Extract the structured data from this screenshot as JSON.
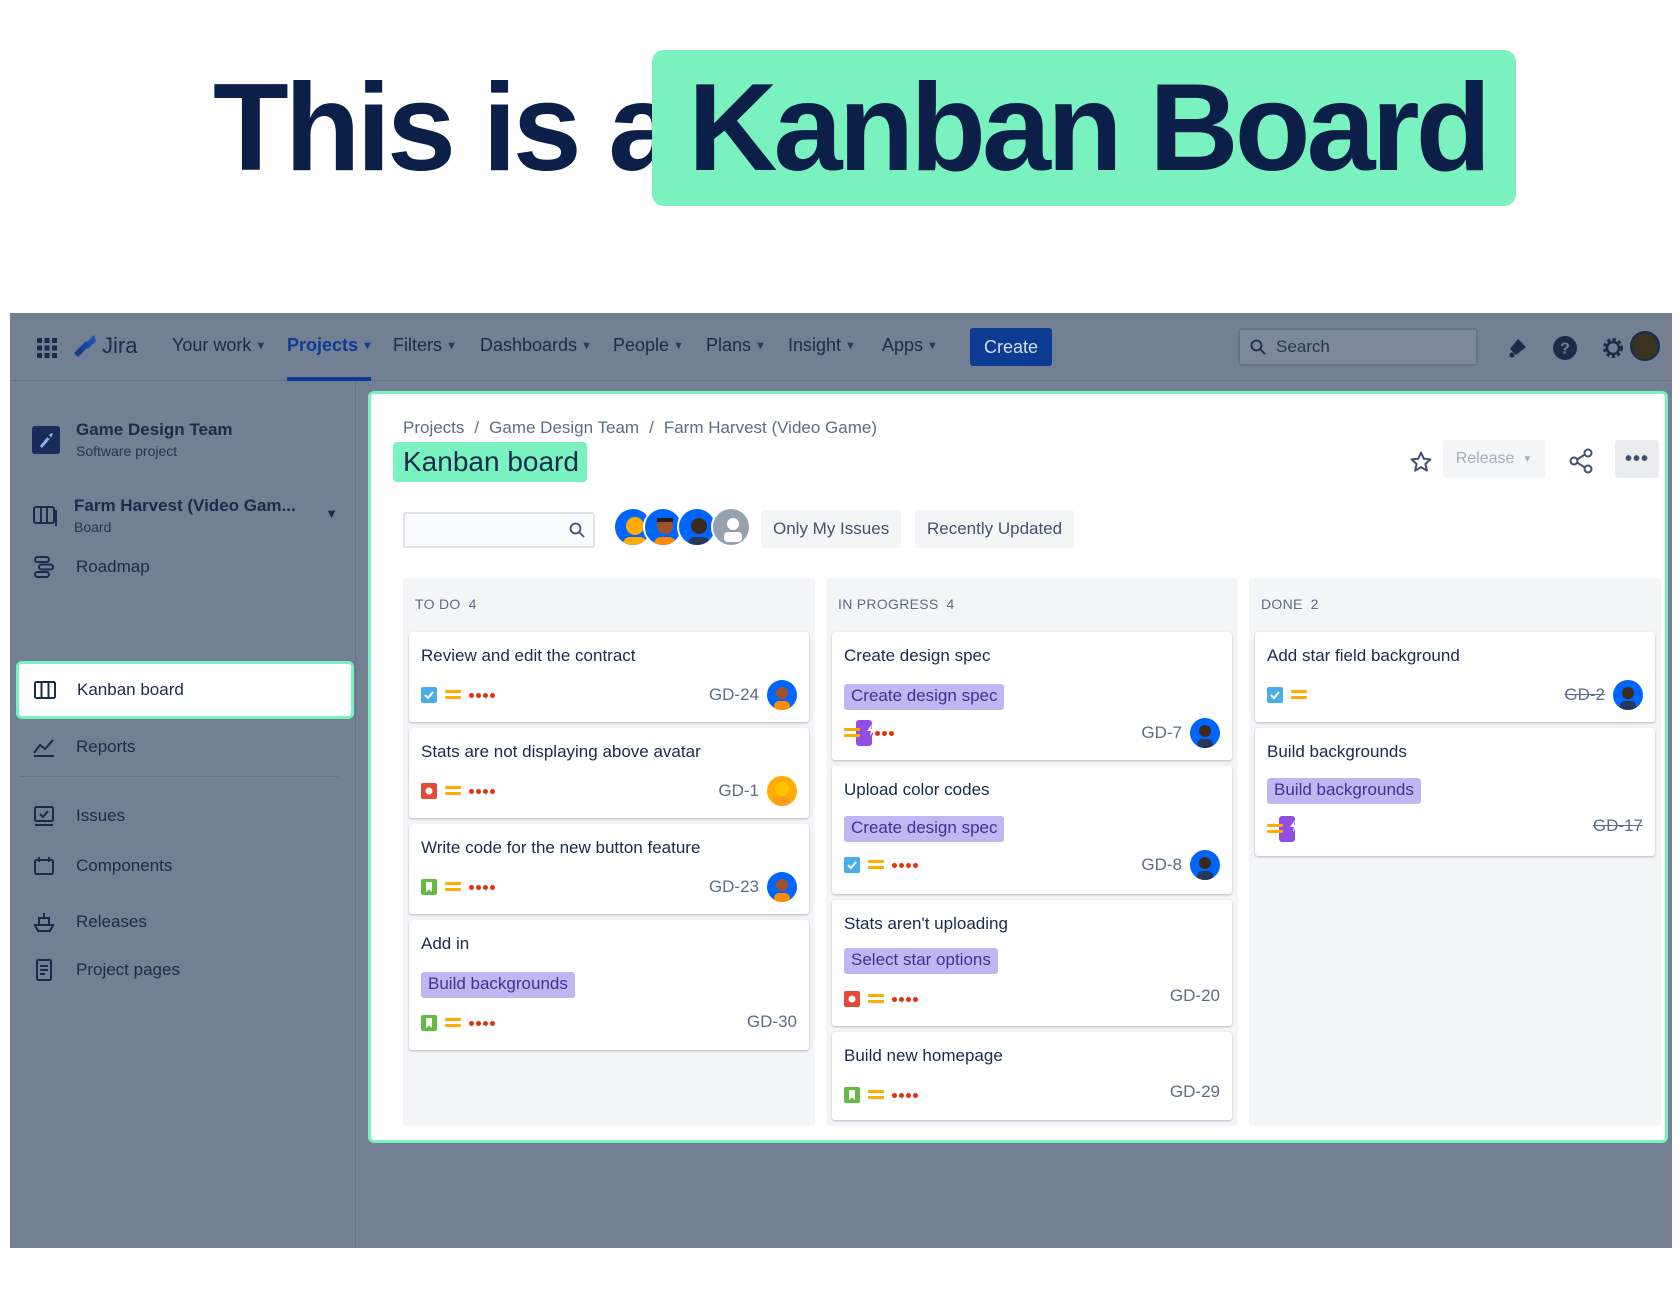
{
  "headline": {
    "plain": "This is a",
    "highlight": "Kanban Board"
  },
  "topnav": {
    "logo": "Jira",
    "items": [
      {
        "label": "Your work",
        "active": false
      },
      {
        "label": "Projects",
        "active": true
      },
      {
        "label": "Filters",
        "active": false
      },
      {
        "label": "Dashboards",
        "active": false
      },
      {
        "label": "People",
        "active": false
      },
      {
        "label": "Plans",
        "active": false
      },
      {
        "label": "Insight",
        "active": false
      },
      {
        "label": "Apps",
        "active": false
      }
    ],
    "create_label": "Create",
    "search_placeholder": "Search"
  },
  "sidebar": {
    "project_name": "Game Design Team",
    "project_type": "Software project",
    "board_name": "Farm Harvest (Video Gam...",
    "board_type": "Board",
    "items": [
      {
        "label": "Roadmap",
        "icon": "roadmap-icon"
      },
      {
        "label": "Kanban board",
        "icon": "board-icon",
        "active": true
      },
      {
        "label": "Reports",
        "icon": "reports-icon"
      },
      {
        "label": "Issues",
        "icon": "issues-icon"
      },
      {
        "label": "Components",
        "icon": "components-icon"
      },
      {
        "label": "Releases",
        "icon": "releases-icon"
      },
      {
        "label": "Project pages",
        "icon": "pages-icon"
      }
    ]
  },
  "main": {
    "breadcrumbs": [
      "Projects",
      "/",
      "Game Design Team",
      "/",
      "Farm Harvest (Video Game)"
    ],
    "title": "Kanban board",
    "release_label": "Release",
    "filters": {
      "only_mine": "Only My Issues",
      "recent": "Recently Updated"
    },
    "columns": [
      {
        "name": "TO DO",
        "count": "4",
        "cards": [
          {
            "title": "Review and edit the contract",
            "type": "task",
            "key": "GD-24",
            "assignee": "orange"
          },
          {
            "title": "Stats are not displaying above avatar",
            "type": "bug",
            "key": "GD-1",
            "assignee": "yellow"
          },
          {
            "title": "Write code for the new button feature",
            "type": "story",
            "key": "GD-23",
            "assignee": "orange"
          },
          {
            "title": "Add in",
            "epic": "Build backgrounds",
            "type": "story",
            "key": "GD-30"
          }
        ]
      },
      {
        "name": "IN PROGRESS",
        "count": "4",
        "cards": [
          {
            "title": "Create design spec",
            "epic": "Create design spec",
            "type": "epic",
            "key": "GD-7",
            "assignee": "dark"
          },
          {
            "title": "Upload color codes",
            "epic": "Create design spec",
            "type": "task",
            "key": "GD-8",
            "assignee": "dark"
          },
          {
            "title": "Stats aren't uploading",
            "epic": "Select star options",
            "type": "bug",
            "key": "GD-20"
          },
          {
            "title": "Build new homepage",
            "type": "story",
            "key": "GD-29"
          }
        ]
      },
      {
        "name": "DONE",
        "count": "2",
        "cards": [
          {
            "title": "Add star field background",
            "type": "task",
            "key": "GD-2",
            "assignee": "dark"
          },
          {
            "title": "Build backgrounds",
            "epic": "Build backgrounds",
            "type": "epic",
            "key": "GD-17"
          }
        ]
      }
    ]
  },
  "colors": {
    "accent": "#79f2c0",
    "brand": "#0b3b95",
    "epic_bg": "#c0b6f2",
    "epic_text": "#403294"
  }
}
